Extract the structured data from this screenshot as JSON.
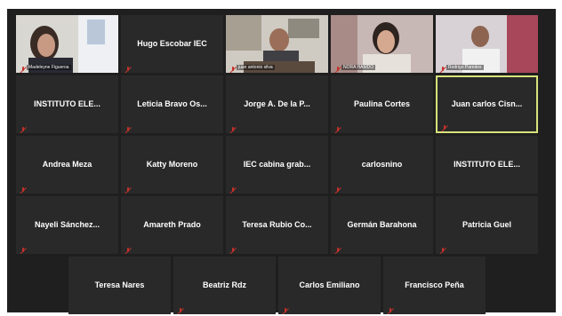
{
  "video_tiles": [
    {
      "caption": "Madeleyne Figueroa"
    },
    {
      "name": "Hugo Escobar IEC"
    },
    {
      "caption": "juan antonio silva"
    },
    {
      "caption": "NORA HAMDO"
    },
    {
      "caption": "Rodrigo Paredes"
    }
  ],
  "rows": [
    [
      "INSTITUTO ELE...",
      "Leticia Bravo Os...",
      "Jorge A. De la P...",
      "Paulina Cortes",
      "Juan carlos Cisn..."
    ],
    [
      "Andrea Meza",
      "Katty Moreno",
      "IEC cabina grab...",
      "carlosnino",
      "INSTITUTO ELE..."
    ],
    [
      "Nayeli Sánchez...",
      "Amareth Prado",
      "Teresa Rubio Co...",
      "Germán Barahona",
      "Patricia Guel"
    ],
    [
      "Teresa Nares",
      "Beatriz Rdz",
      "Carlos Emiliano",
      "Francisco Peña"
    ]
  ],
  "colors": {
    "active_speaker_border": "#d9e37a",
    "mute_icon": "#c4312b"
  }
}
